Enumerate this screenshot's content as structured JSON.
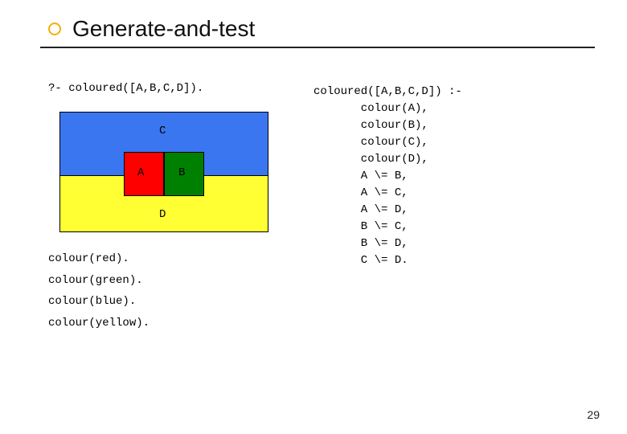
{
  "title": "Generate-and-test",
  "query": "?- coloured([A,B,C,D]).",
  "diagram": {
    "labelA": "A",
    "labelB": "B",
    "labelC": "C",
    "labelD": "D"
  },
  "facts": {
    "red": "colour(red).",
    "green": "colour(green).",
    "blue": "colour(blue).",
    "yellow": "colour(yellow)."
  },
  "clause": "coloured([A,B,C,D]) :-\n       colour(A),\n       colour(B),\n       colour(C),\n       colour(D),\n       A \\= B,\n       A \\= C,\n       A \\= D,\n       B \\= C,\n       B \\= D,\n       C \\= D.",
  "pagenum": "29"
}
